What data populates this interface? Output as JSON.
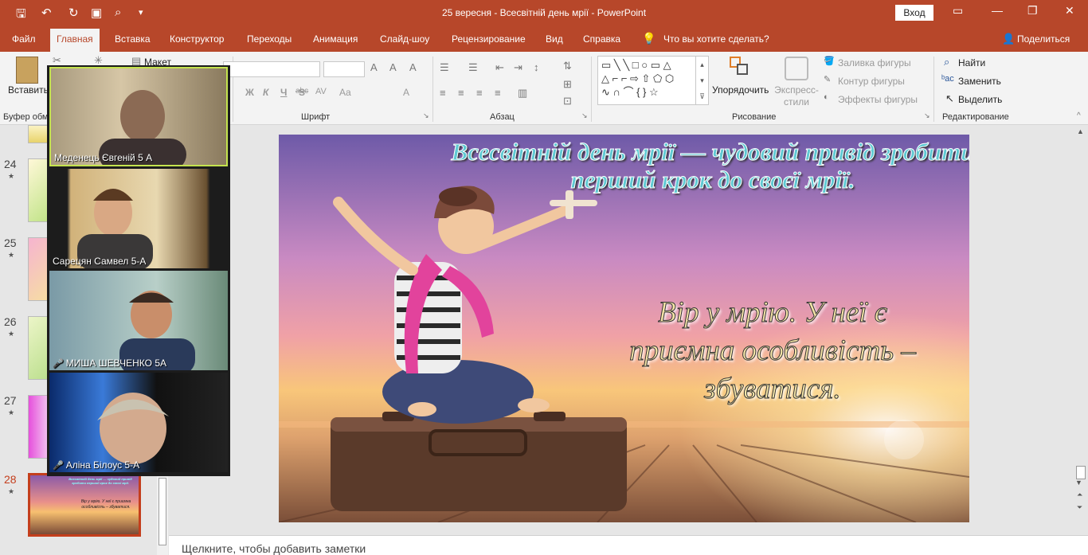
{
  "window": {
    "title": "25 вересня - Всесвітній день мрії  -  PowerPoint",
    "signin_label": "Вход",
    "qa_icons": [
      "save-icon",
      "undo-icon",
      "redo-icon",
      "present-icon",
      "preview-icon",
      "customize-icon"
    ]
  },
  "tabs": [
    {
      "label": "Файл"
    },
    {
      "label": "Главная",
      "active": true
    },
    {
      "label": "Вставка"
    },
    {
      "label": "Конструктор"
    },
    {
      "label": "Переходы"
    },
    {
      "label": "Анимация"
    },
    {
      "label": "Слайд-шоу"
    },
    {
      "label": "Рецензирование"
    },
    {
      "label": "Вид"
    },
    {
      "label": "Справка"
    }
  ],
  "tell_me": "Что вы хотите сделать?",
  "share_label": "Поделиться",
  "ribbon": {
    "paste_label": "Вставить",
    "clipboard_group": "Буфер обм",
    "layout_label": "Макет",
    "font_group": "Шрифт",
    "font_buttons": [
      "Ж",
      "К",
      "Ч",
      "S",
      "abc",
      "AV",
      "Aa",
      "A"
    ],
    "paragraph_group": "Абзац",
    "arrange_label": "Упорядочить",
    "quick_styles_label": "Экспресс-стили",
    "shape_fill": "Заливка фигуры",
    "shape_outline": "Контур фигуры",
    "shape_effects": "Эффекты фигуры",
    "drawing_group": "Рисование",
    "find_label": "Найти",
    "replace_label": "Заменить",
    "select_label": "Выделить",
    "editing_group": "Редактирование"
  },
  "slides_pane": [
    {
      "number": "24"
    },
    {
      "number": "25"
    },
    {
      "number": "26"
    },
    {
      "number": "27"
    },
    {
      "number": "28",
      "active": true
    }
  ],
  "slide": {
    "title": "Всесвітній день мрії — чудовий привід зробити перший крок до своєї мрії.",
    "body": "Вір у мрію. У неї є приємна особливість – збуватися."
  },
  "thumb_28": {
    "title": "Всесвітній день мрії — чудовий привід зробити перший крок до своєї мрії.",
    "body": "Вір у мрію. У неї є приємна особливість – збуватися."
  },
  "notes_placeholder": "Щелкните, чтобы добавить заметки",
  "participants": [
    {
      "name": "Меденець Євгеній 5 А",
      "muted": false,
      "speaking": true
    },
    {
      "name": "Сарецян Самвел 5-А",
      "muted": false,
      "speaking": false
    },
    {
      "name": "МИША ШЕВЧЕНКО 5А",
      "muted": true,
      "speaking": false
    },
    {
      "name": "Аліна Білоус 5-А",
      "muted": true,
      "speaking": false
    }
  ],
  "colors": {
    "accent": "#b7472a",
    "active_slide": "#c43e1c",
    "speaker_border": "#c4e34e"
  }
}
